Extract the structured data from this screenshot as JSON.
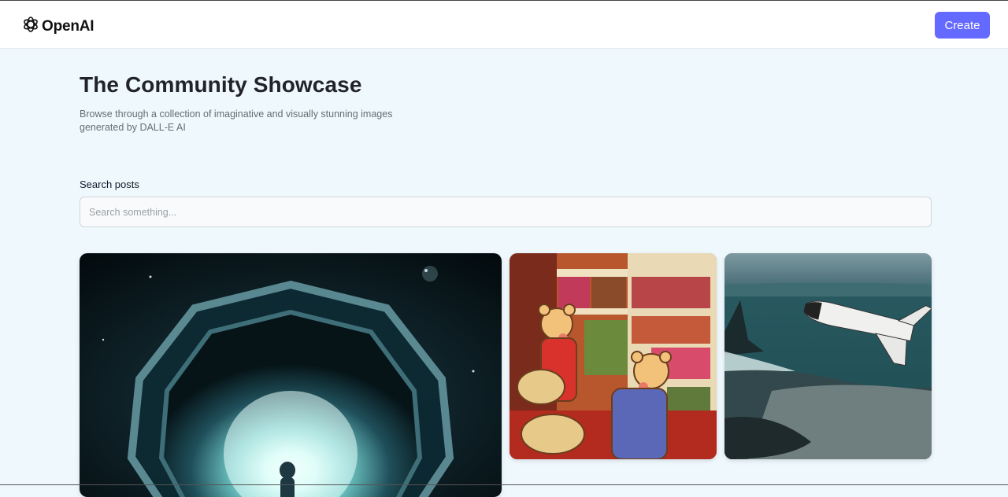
{
  "header": {
    "logo_text": "OpenAI",
    "logo_icon": "openai-logo-icon",
    "create_label": "Create",
    "accent_color": "#6469ff"
  },
  "main": {
    "title": "The Community Showcase",
    "subtitle": "Browse through a collection of imaginative and visually stunning images generated by DALL-E AI",
    "search": {
      "label": "Search posts",
      "placeholder": "Search something...",
      "value": ""
    }
  },
  "gallery": {
    "cards": [
      {
        "name": "cosmic-tunnel-image"
      },
      {
        "name": "teddy-bears-shopping-image"
      },
      {
        "name": "space-shuttle-over-coast-image"
      }
    ]
  }
}
